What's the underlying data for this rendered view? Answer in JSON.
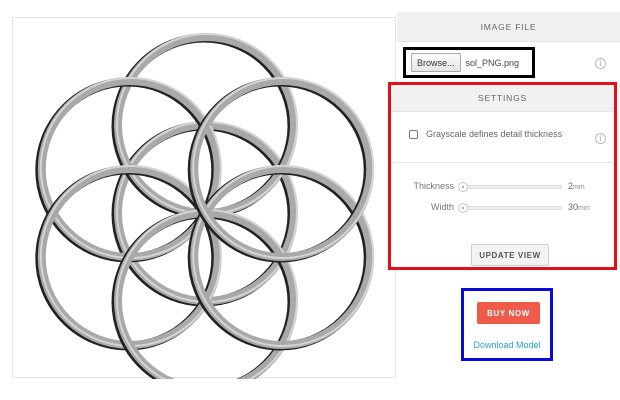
{
  "image_file": {
    "header": "IMAGE FILE",
    "browse_label": "Browse...",
    "file_name": "sol_PNG.png",
    "info_icon": "i"
  },
  "settings": {
    "header": "SETTINGS",
    "grayscale_label": "Grayscale defines detail thickness",
    "grayscale_checked": false,
    "thickness_label": "Thickness",
    "thickness_value": "2",
    "thickness_unit": "mm",
    "thickness_level": 0.0,
    "width_label": "Width",
    "width_value": "30",
    "width_unit": "mm",
    "width_level": 0.0,
    "update_label": "UPDATE VIEW"
  },
  "purchase": {
    "buy_label": "BUY NOW",
    "download_label": "Download Model"
  },
  "preview": {
    "ring_color": "#a9a9a9",
    "shadow_color": "#222222",
    "image_name": "seed-of-life-rings"
  },
  "annotation_colors": {
    "file_box": "#000000",
    "settings_box": "#e0101b",
    "buy_box": "#0a0ad8"
  },
  "accent": {
    "buy": "#f05a4b",
    "link": "#2a9fd6"
  }
}
